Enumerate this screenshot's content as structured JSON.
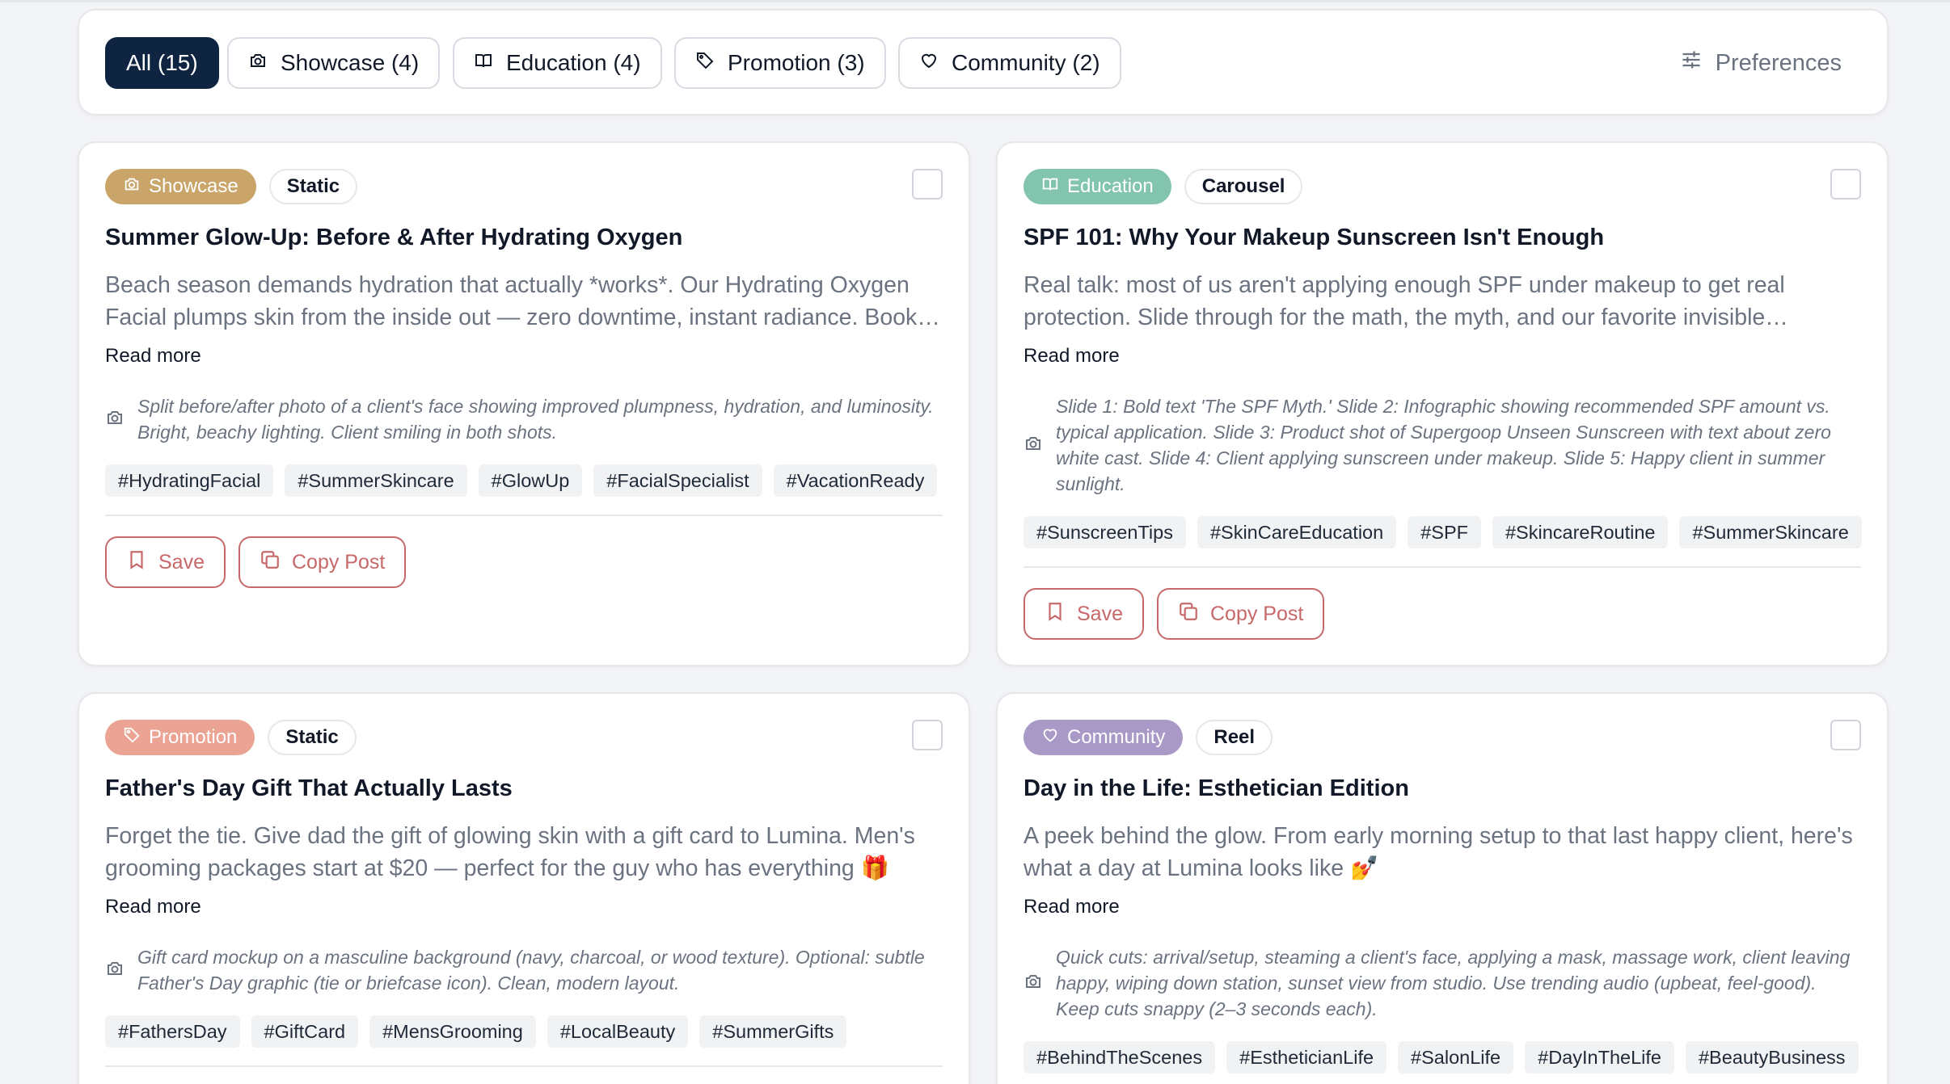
{
  "filters": {
    "all": "All (15)",
    "showcase": "Showcase (4)",
    "education": "Education (4)",
    "promotion": "Promotion (3)",
    "community": "Community (2)",
    "preferences": "Preferences"
  },
  "colors": {
    "active_filter_bg": "#0e2440",
    "showcase": "#c9a56a",
    "education": "#82c4ae",
    "promotion": "#eba393",
    "community": "#a899c6",
    "action_accent": "#c7686a"
  },
  "actions": {
    "save": "Save",
    "copy": "Copy Post"
  },
  "read_more": "Read more",
  "posts": [
    {
      "category": "Showcase",
      "category_icon": "camera-icon",
      "format": "Static",
      "title": "Summer Glow-Up: Before & After Hydrating Oxygen",
      "body": "Beach season demands hydration that actually *works*. Our Hydrating Oxygen Facial plumps skin from the inside out — zero downtime, instant radiance. Book your glow session today.",
      "visual": "Split before/after photo of a client's face showing improved plumpness, hydration, and luminosity. Bright, beachy lighting. Client smiling in both shots.",
      "tags": [
        "#HydratingFacial",
        "#SummerSkincare",
        "#GlowUp",
        "#FacialSpecialist",
        "#VacationReady"
      ]
    },
    {
      "category": "Education",
      "category_icon": "book-icon",
      "format": "Carousel",
      "title": "SPF 101: Why Your Makeup Sunscreen Isn't Enough",
      "body": "Real talk: most of us aren't applying enough SPF under makeup to get real protection. Slide through for the math, the myth, and our favorite invisible sunscreen.",
      "visual": "Slide 1: Bold text 'The SPF Myth.' Slide 2: Infographic showing recommended SPF amount vs. typical application. Slide 3: Product shot of Supergoop Unseen Sunscreen with text about zero white cast. Slide 4: Client applying sunscreen under makeup. Slide 5: Happy client in summer sunlight.",
      "tags": [
        "#SunscreenTips",
        "#SkinCareEducation",
        "#SPF",
        "#SkincareRoutine",
        "#SummerSkincare"
      ]
    },
    {
      "category": "Promotion",
      "category_icon": "tag-icon",
      "format": "Static",
      "title": "Father's Day Gift That Actually Lasts",
      "body": "Forget the tie. Give dad the gift of glowing skin with a gift card to Lumina. Men's grooming packages start at $20 — perfect for the guy who has everything 🎁",
      "visual": "Gift card mockup on a masculine background (navy, charcoal, or wood texture). Optional: subtle Father's Day graphic (tie or briefcase icon). Clean, modern layout.",
      "tags": [
        "#FathersDay",
        "#GiftCard",
        "#MensGrooming",
        "#LocalBeauty",
        "#SummerGifts"
      ]
    },
    {
      "category": "Community",
      "category_icon": "heart-icon",
      "format": "Reel",
      "title": "Day in the Life: Esthetician Edition",
      "body": "A peek behind the glow. From early morning setup to that last happy client, here's what a day at Lumina looks like 💅",
      "visual": "Quick cuts: arrival/setup, steaming a client's face, applying a mask, massage work, client leaving happy, wiping down station, sunset view from studio. Use trending audio (upbeat, feel-good). Keep cuts snappy (2–3 seconds each).",
      "tags": [
        "#BehindTheScenes",
        "#EstheticianLife",
        "#SalonLife",
        "#DayInTheLife",
        "#BeautyBusiness"
      ]
    }
  ]
}
